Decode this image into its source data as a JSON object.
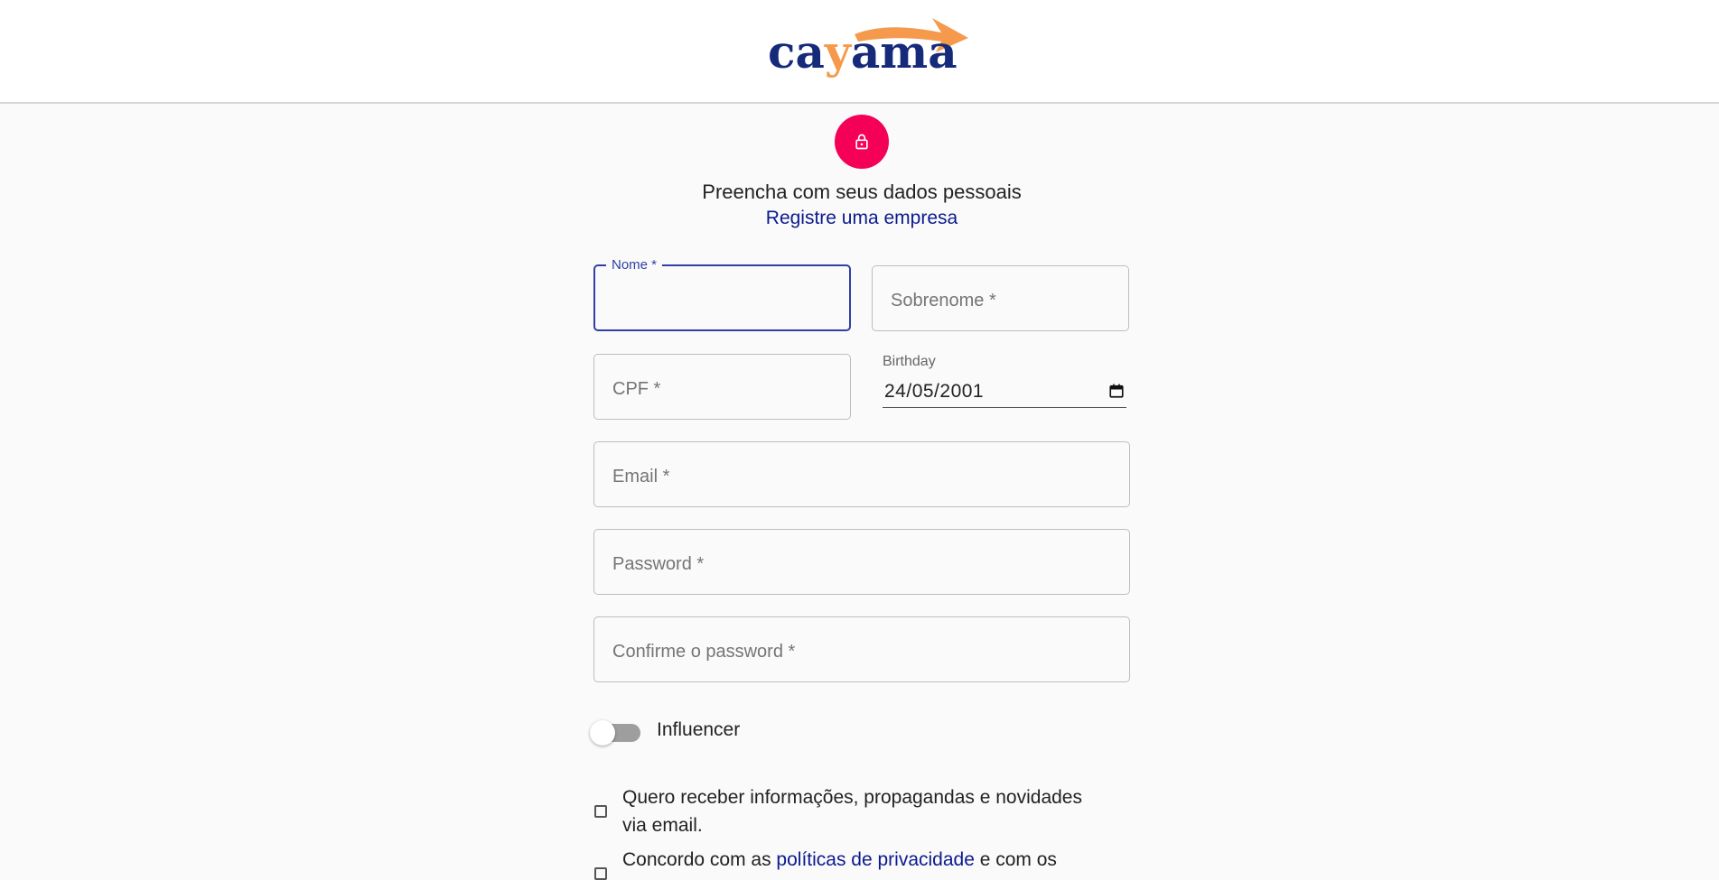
{
  "header": {
    "logo_part1": "ca",
    "logo_part2": "y",
    "logo_part3": "ama",
    "logo_colors": {
      "text": "#162a7a",
      "accent": "#f59a4c"
    }
  },
  "intro": {
    "icon": "lock-icon",
    "icon_bg": "#f50057",
    "subtitle": "Preencha com seus dados pessoais",
    "company_link": "Registre uma empresa"
  },
  "form": {
    "first_name": {
      "label": "Nome *",
      "value": ""
    },
    "last_name": {
      "placeholder": "Sobrenome *",
      "value": ""
    },
    "cpf": {
      "placeholder": "CPF *",
      "value": ""
    },
    "birthday": {
      "label": "Birthday",
      "value": "24/05/2001",
      "icon": "calendar-icon"
    },
    "email": {
      "placeholder": "Email *",
      "value": ""
    },
    "password": {
      "placeholder": "Password *",
      "value": ""
    },
    "confirm_password": {
      "placeholder": "Confirme o password *",
      "value": ""
    },
    "influencer_toggle": {
      "label": "Influencer",
      "on": false
    },
    "newsletter_checkbox": {
      "line1": "Quero receber informações, propagandas e novidades",
      "line2": "via email.",
      "checked": false
    },
    "privacy_checkbox": {
      "text_before": "Concordo com as ",
      "link": "políticas de privacidade",
      "text_after": " e com os",
      "checked": false
    }
  },
  "colors": {
    "primary": "#2f3fa6",
    "link": "#0b1a8f",
    "avatar": "#f50057"
  }
}
